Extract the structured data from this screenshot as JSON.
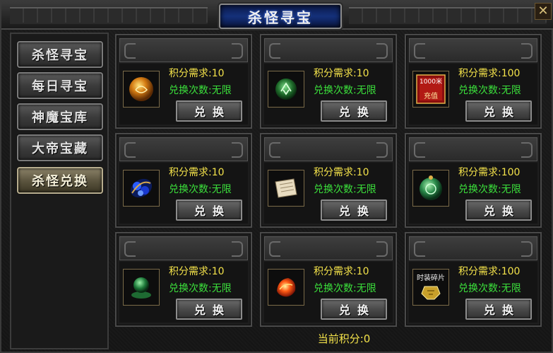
{
  "window": {
    "title": "杀怪寻宝"
  },
  "sidebar": {
    "items": [
      {
        "label": "杀怪寻宝",
        "active": false
      },
      {
        "label": "每日寻宝",
        "active": false
      },
      {
        "label": "神魔宝库",
        "active": false
      },
      {
        "label": "大帝宝藏",
        "active": false
      },
      {
        "label": "杀怪兑换",
        "active": true
      }
    ]
  },
  "exchange_items": [
    {
      "icon": "golden-orb-icon",
      "cost": "积分需求:10",
      "limit": "兑换次数:无限",
      "button": "兑换"
    },
    {
      "icon": "green-rune-icon",
      "cost": "积分需求:10",
      "limit": "兑换次数:无限",
      "button": "兑换"
    },
    {
      "icon": "recharge-card-icon",
      "card_top": "1000米",
      "card_main": "充值",
      "cost": "积分需求:100",
      "limit": "兑换次数:无限",
      "button": "兑换"
    },
    {
      "icon": "blue-gem-cluster-icon",
      "cost": "积分需求:10",
      "limit": "兑换次数:无限",
      "button": "兑换"
    },
    {
      "icon": "scroll-icon",
      "cost": "积分需求:10",
      "limit": "兑换次数:无限",
      "button": "兑换"
    },
    {
      "icon": "jade-orb-icon",
      "cost": "积分需求:100",
      "limit": "兑换次数:无限",
      "button": "兑换"
    },
    {
      "icon": "jade-stone-icon",
      "cost": "积分需求:10",
      "limit": "兑换次数:无限",
      "button": "兑换"
    },
    {
      "icon": "fire-crystal-icon",
      "cost": "积分需求:10",
      "limit": "兑换次数:无限",
      "button": "兑换"
    },
    {
      "icon": "costume-shard-icon",
      "shard_label": "时装碎片",
      "cost": "积分需求:100",
      "limit": "兑换次数:无限",
      "button": "兑换"
    }
  ],
  "footer": {
    "points": "当前积分:0"
  },
  "colors": {
    "cost": "#f3e24a",
    "limit": "#3be03b",
    "title_plate": "#14307a"
  }
}
